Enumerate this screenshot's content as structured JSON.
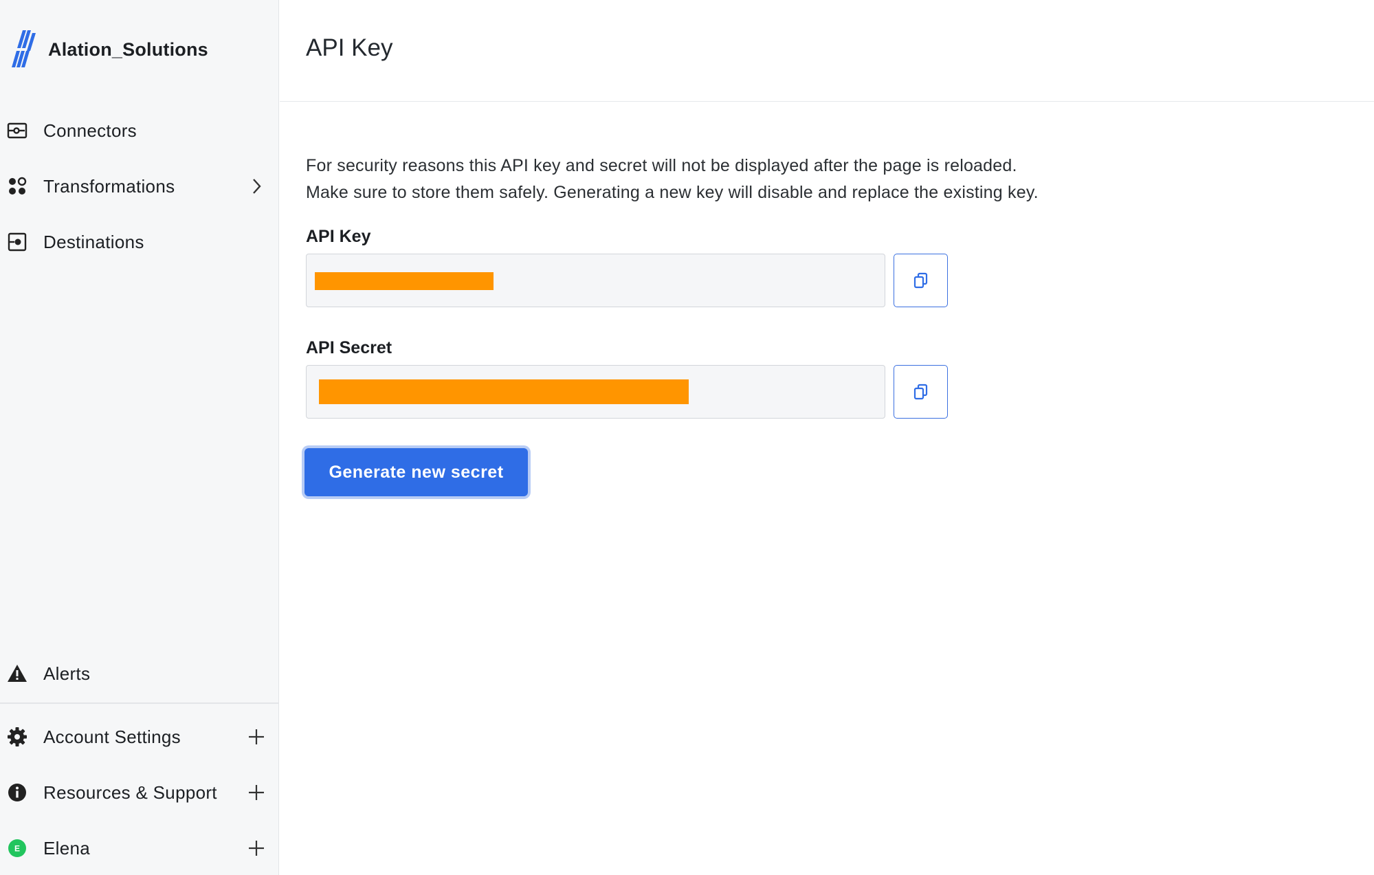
{
  "app": {
    "org_name": "Alation_Solutions",
    "brand_color": "#2f6de6"
  },
  "sidebar": {
    "items": [
      {
        "label": "Connectors",
        "icon": "connectors-icon"
      },
      {
        "label": "Transformations",
        "icon": "transformations-icon",
        "trail": "chevron-right-icon"
      },
      {
        "label": "Destinations",
        "icon": "destinations-icon"
      }
    ],
    "bottom_items": [
      {
        "label": "Alerts",
        "icon": "warning-icon"
      },
      {
        "label": "Account Settings",
        "icon": "gear-icon",
        "trail": "plus-icon"
      },
      {
        "label": "Resources & Support",
        "icon": "info-icon",
        "trail": "plus-icon"
      },
      {
        "label": "Elena",
        "icon": "user-avatar",
        "avatar_initial": "E",
        "avatar_color": "#22c55e",
        "trail": "plus-icon"
      }
    ]
  },
  "page": {
    "title": "API Key",
    "description_line1": "For security reasons this API key and secret will not be displayed after the page is reloaded.",
    "description_line2": "Make sure to store them safely. Generating a new key will disable and replace the existing key.",
    "api_key_label": "API Key",
    "api_secret_label": "API Secret",
    "generate_button": "Generate new secret",
    "redaction_color": "#ff9500"
  }
}
